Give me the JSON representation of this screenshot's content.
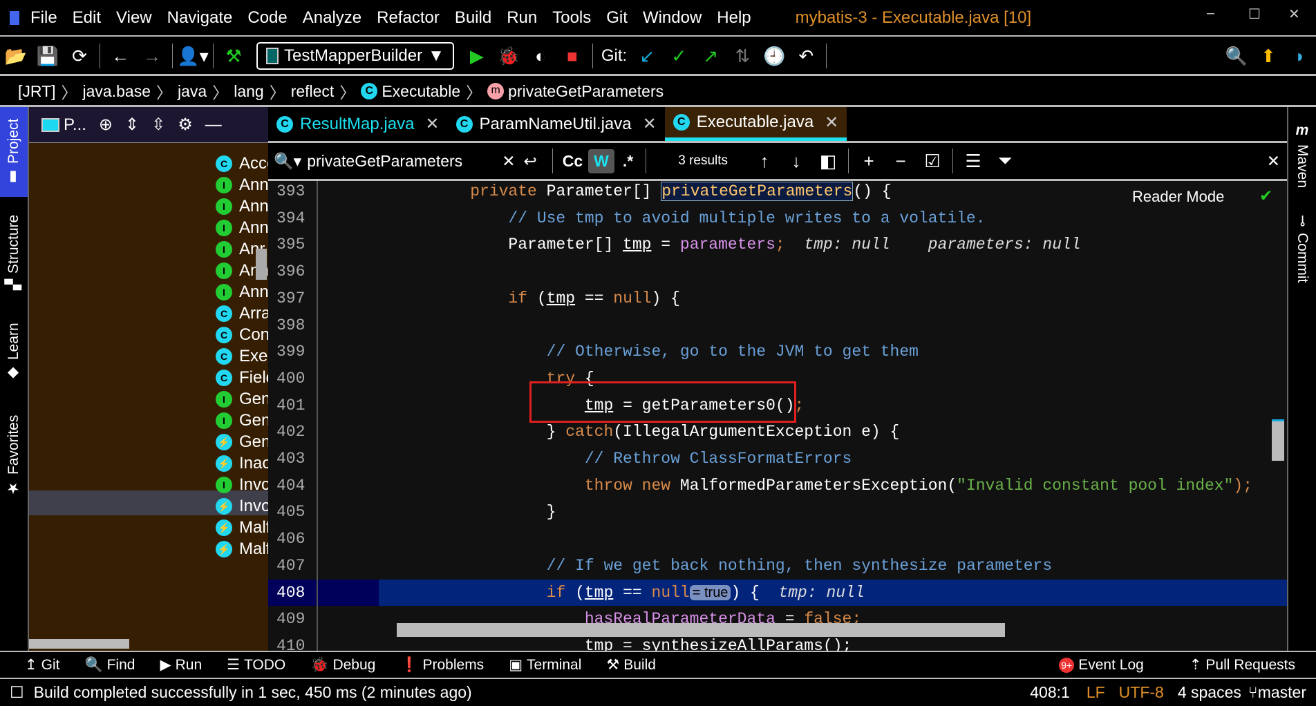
{
  "window": {
    "title": "mybatis-3 - Executable.java [10]",
    "menu": [
      "File",
      "Edit",
      "View",
      "Navigate",
      "Code",
      "Analyze",
      "Refactor",
      "Build",
      "Run",
      "Tools",
      "Git",
      "Window",
      "Help"
    ]
  },
  "toolbar": {
    "run_config": "TestMapperBuilder",
    "git_label": "Git:"
  },
  "breadcrumb": [
    "[JRT]",
    "java.base",
    "java",
    "lang",
    "reflect",
    "Executable",
    "privateGetParameters"
  ],
  "left_stripe": [
    "Project",
    "Structure",
    "Learn",
    "Favorites"
  ],
  "right_stripe": [
    "Maven",
    "Commit"
  ],
  "project": {
    "header_label": "P...",
    "items": [
      {
        "label": "Acces",
        "type": "c"
      },
      {
        "label": "Annc",
        "type": "i"
      },
      {
        "label": "Annc",
        "type": "i"
      },
      {
        "label": "Annc",
        "type": "i"
      },
      {
        "label": "Anr",
        "type": "i"
      },
      {
        "label": "Annc",
        "type": "i"
      },
      {
        "label": "Annc",
        "type": "i"
      },
      {
        "label": "Array",
        "type": "c"
      },
      {
        "label": "Cons",
        "type": "c"
      },
      {
        "label": "Execu",
        "type": "c"
      },
      {
        "label": "Field",
        "type": "c"
      },
      {
        "label": "Gene",
        "type": "i"
      },
      {
        "label": "Gene",
        "type": "i"
      },
      {
        "label": "Gene",
        "type": "e"
      },
      {
        "label": "Inacc",
        "type": "e"
      },
      {
        "label": "Invoc",
        "type": "i"
      },
      {
        "label": "Invoc",
        "type": "e"
      },
      {
        "label": "Malfc",
        "type": "e"
      },
      {
        "label": "Malfc",
        "type": "e"
      }
    ],
    "selected_index": 9
  },
  "tabs": [
    {
      "label": "ResultMap.java",
      "active": false
    },
    {
      "label": "ParamNameUtil.java",
      "active": false
    },
    {
      "label": "Executable.java",
      "active": true
    }
  ],
  "find": {
    "query": "privateGetParameters",
    "results": "3 results",
    "match_case": "Cc",
    "words": "W",
    "regex": ".*"
  },
  "editor": {
    "reader_mode": "Reader Mode",
    "current_line": 408,
    "lines": [
      {
        "n": "393",
        "t": [
          [
            "    ",
            "p"
          ],
          [
            "private ",
            "k"
          ],
          [
            "Parameter[] ",
            "p"
          ],
          [
            "privateGetParameters",
            "hl"
          ],
          [
            "() {",
            "p"
          ]
        ]
      },
      {
        "n": "394",
        "t": [
          [
            "        ",
            "p"
          ],
          [
            "// Use tmp to avoid multiple writes to a volatile.",
            "cm"
          ]
        ]
      },
      {
        "n": "395",
        "t": [
          [
            "        Parameter[] ",
            "p"
          ],
          [
            "tmp",
            "p u"
          ],
          [
            " = ",
            "p"
          ],
          [
            "parameters",
            "f"
          ],
          [
            ";",
            "k"
          ],
          [
            "  tmp: null    parameters: null",
            "i"
          ]
        ]
      },
      {
        "n": "396",
        "t": []
      },
      {
        "n": "397",
        "t": [
          [
            "        ",
            "p"
          ],
          [
            "if ",
            "k"
          ],
          [
            "(",
            "p"
          ],
          [
            "tmp",
            "p u"
          ],
          [
            " == ",
            "p"
          ],
          [
            "null",
            "k"
          ],
          [
            ") {",
            "p"
          ]
        ]
      },
      {
        "n": "398",
        "t": []
      },
      {
        "n": "399",
        "t": [
          [
            "            ",
            "p"
          ],
          [
            "// Otherwise, go to the JVM to get them",
            "cm"
          ]
        ]
      },
      {
        "n": "400",
        "t": [
          [
            "            ",
            "p"
          ],
          [
            "try ",
            "k"
          ],
          [
            "{",
            "p"
          ]
        ]
      },
      {
        "n": "401",
        "t": [
          [
            "                ",
            "p"
          ],
          [
            "tmp",
            "p u"
          ],
          [
            " = getParameters0()",
            "p"
          ],
          [
            ";",
            "k"
          ]
        ]
      },
      {
        "n": "402",
        "t": [
          [
            "            } ",
            "p"
          ],
          [
            "catch",
            "k"
          ],
          [
            "(IllegalArgumentException e) {",
            "p"
          ]
        ]
      },
      {
        "n": "403",
        "t": [
          [
            "                ",
            "p"
          ],
          [
            "// Rethrow ClassFormatErrors",
            "cm"
          ]
        ]
      },
      {
        "n": "404",
        "t": [
          [
            "                ",
            "p"
          ],
          [
            "throw new ",
            "k"
          ],
          [
            "MalformedParametersException(",
            "p"
          ],
          [
            "\"Invalid constant pool index\"",
            "s"
          ],
          [
            ");",
            "k"
          ]
        ]
      },
      {
        "n": "405",
        "t": [
          [
            "            }",
            "p"
          ]
        ]
      },
      {
        "n": "406",
        "t": []
      },
      {
        "n": "407",
        "t": [
          [
            "            ",
            "p"
          ],
          [
            "// If we get back nothing, then synthesize parameters",
            "cm"
          ]
        ]
      },
      {
        "n": "408",
        "t": [
          [
            "            ",
            "p"
          ],
          [
            "if ",
            "k"
          ],
          [
            "(",
            "p"
          ],
          [
            "tmp",
            "p u"
          ],
          [
            " == ",
            "p"
          ],
          [
            "null",
            "k"
          ],
          [
            "= true",
            "pill"
          ],
          [
            ") {  ",
            "p"
          ],
          [
            "tmp: null",
            "i"
          ]
        ]
      },
      {
        "n": "409",
        "t": [
          [
            "                ",
            "p"
          ],
          [
            "hasRealParameterData",
            "f"
          ],
          [
            " = ",
            "p"
          ],
          [
            "false",
            "k"
          ],
          [
            ";",
            "k"
          ]
        ]
      },
      {
        "n": "410",
        "t": [
          [
            "                tmp = synthesizeAllParams();",
            "p"
          ]
        ]
      }
    ]
  },
  "tool_windows": [
    "Git",
    "Find",
    "Run",
    "TODO",
    "Debug",
    "Problems",
    "Terminal",
    "Build"
  ],
  "tool_windows_right": [
    {
      "label": "Event Log",
      "badge": "9+"
    },
    {
      "label": "Pull Requests"
    }
  ],
  "status": {
    "message": "Build completed successfully in 1 sec, 450 ms (2 minutes ago)",
    "position": "408:1",
    "line_sep": "LF",
    "encoding": "UTF-8",
    "indent": "4 spaces",
    "branch": "master"
  },
  "colors": {
    "accent": "#1ce0f0",
    "keyword": "#d88a4a",
    "comment": "#6aa0d8",
    "string": "#6ab04a",
    "field": "#d890e8",
    "current_line": "#02247a",
    "red_box": "#e02020",
    "title": "#e0902a"
  }
}
